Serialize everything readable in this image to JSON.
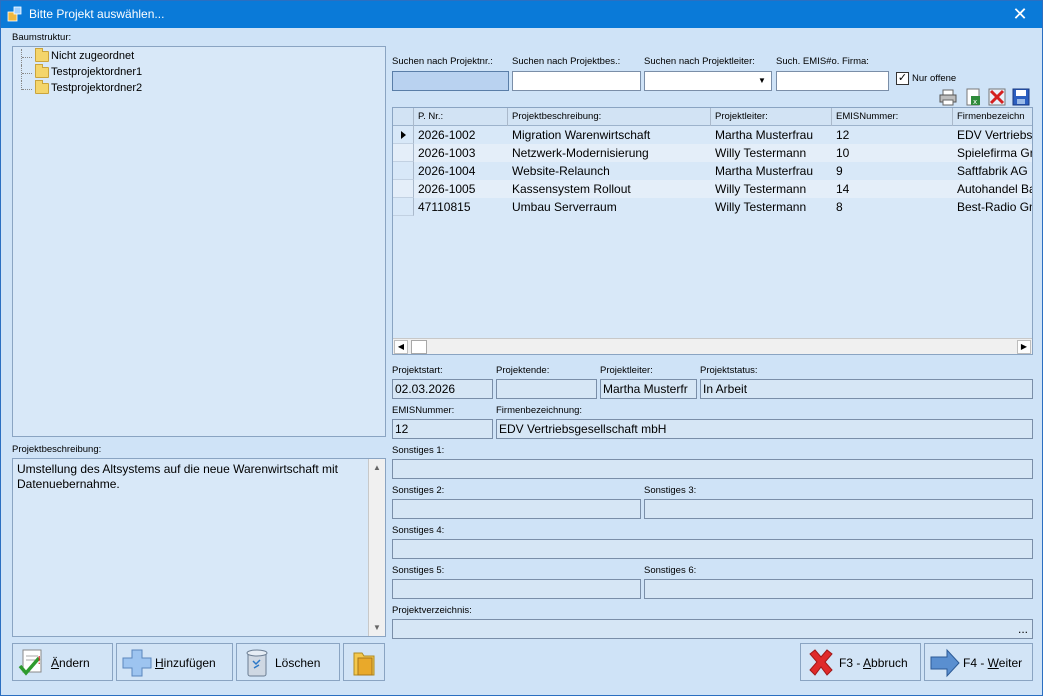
{
  "window": {
    "title": "Bitte Projekt auswählen...",
    "close_glyph": "✕"
  },
  "tree": {
    "label": "Baumstruktur:",
    "items": [
      "Nicht zugeordnet",
      "Testprojektordner1",
      "Testprojektordner2"
    ]
  },
  "search": {
    "projnr_label": "Suchen nach Projektnr.:",
    "projbes_label": "Suchen nach Projektbes.:",
    "leiter_label": "Suchen nach Projektleiter:",
    "emis_label": "Such. EMIS#o. Firma:",
    "projnr_value": "",
    "projbes_value": "",
    "leiter_value": "",
    "emis_value": "",
    "nur_offene_label": "Nur offene",
    "nur_offene_checked": "✓"
  },
  "toolbar_icons": [
    "printer-icon",
    "export-excel-icon",
    "delete-icon",
    "save-icon"
  ],
  "grid": {
    "columns": [
      "P. Nr.:",
      "Projektbeschreibung:",
      "Projektleiter:",
      "EMISNummer:",
      "Firmenbezeichn"
    ],
    "rows": [
      [
        "2026-1002",
        "Migration Warenwirtschaft",
        "Martha Musterfrau",
        "12",
        "EDV Vertriebsg"
      ],
      [
        "2026-1003",
        "Netzwerk-Modernisierung",
        "Willy Testermann",
        "10",
        "Spielefirma Gr"
      ],
      [
        "2026-1004",
        "Website-Relaunch",
        "Martha Musterfrau",
        "9",
        "Saftfabrik AG"
      ],
      [
        "2026-1005",
        "Kassensystem Rollout",
        "Willy Testermann",
        "14",
        "Autohandel Ba"
      ],
      [
        "47110815",
        "Umbau Serverraum",
        "Willy Testermann",
        "8",
        "Best-Radio Gm"
      ]
    ]
  },
  "details": {
    "projektstart_label": "Projektstart:",
    "projektstart": "02.03.2026",
    "projektende_label": "Projektende:",
    "projektende": "",
    "projektleiter_label": "Projektleiter:",
    "projektleiter": "Martha Musterfr",
    "projektstatus_label": "Projektstatus:",
    "projektstatus": "In Arbeit",
    "emis_label": "EMISNummer:",
    "emis": "12",
    "firma_label": "Firmenbezeichnung:",
    "firma": "EDV Vertriebsgesellschaft mbH",
    "sonstiges1_label": "Sonstiges 1:",
    "sonstiges2_label": "Sonstiges 2:",
    "sonstiges3_label": "Sonstiges 3:",
    "sonstiges4_label": "Sonstiges 4:",
    "sonstiges5_label": "Sonstiges 5:",
    "sonstiges6_label": "Sonstiges 6:",
    "verzeichnis_label": "Projektverzeichnis:",
    "verzeichnis_browse": "..."
  },
  "description": {
    "label": "Projektbeschreibung:",
    "text": "Umstellung des Altsystems auf die neue Warenwirtschaft mit Datenuebernahme."
  },
  "buttons": {
    "aendern_u": "Ä",
    "aendern_rest": "ndern",
    "hinzufuegen_u": "H",
    "hinzufuegen_rest": "inzufügen",
    "loeschen": "Löschen",
    "abbruch_pre": "F3 - ",
    "abbruch_u": "A",
    "abbruch_rest": "bbruch",
    "weiter_pre": "F4 - ",
    "weiter_u": "W",
    "weiter_rest": "eiter"
  }
}
